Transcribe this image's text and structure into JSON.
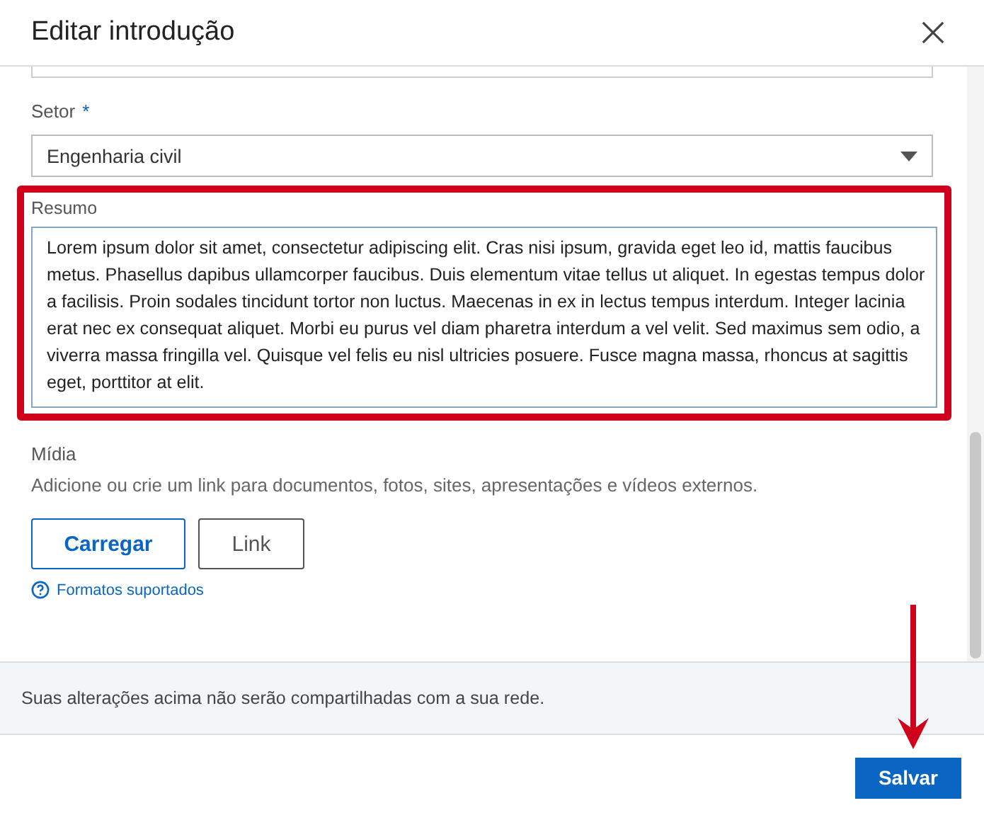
{
  "dialog": {
    "title": "Editar introdução"
  },
  "sector": {
    "label": "Setor",
    "required_mark": "*",
    "value": "Engenharia civil"
  },
  "summary": {
    "label": "Resumo",
    "value": "Lorem ipsum dolor sit amet, consectetur adipiscing elit. Cras nisi ipsum, gravida eget leo id, mattis faucibus metus. Phasellus dapibus ullamcorper faucibus. Duis elementum vitae tellus ut aliquet. In egestas tempus dolor a facilisis. Proin sodales tincidunt tortor non luctus. Maecenas in ex in lectus tempus interdum. Integer lacinia erat nec ex consequat aliquet. Morbi eu purus vel diam pharetra interdum a vel velit. Sed maximus sem odio, a viverra massa fringilla vel. Quisque vel felis eu nisl ultricies posuere. Fusce magna massa, rhoncus at sagittis eget, porttitor at elit."
  },
  "media": {
    "label": "Mídia",
    "description": "Adicione ou crie um link para documentos, fotos, sites, apresentações e vídeos externos.",
    "buttons": [
      {
        "label": "Carregar",
        "kind": "primary"
      },
      {
        "label": "Link",
        "kind": "secondary"
      }
    ],
    "help_link": "Formatos suportados"
  },
  "notice": "Suas alterações acima não serão compartilhadas com a sua rede.",
  "save_button": "Salvar"
}
